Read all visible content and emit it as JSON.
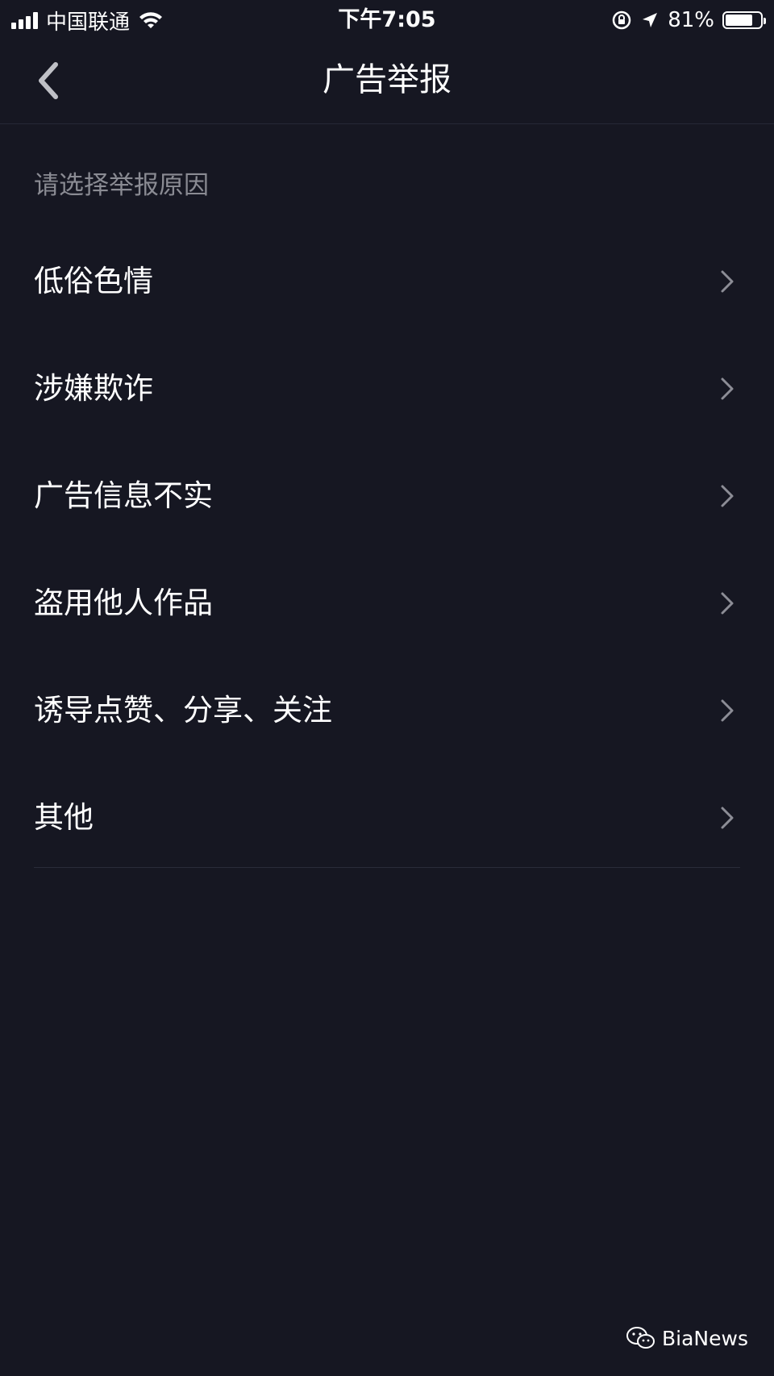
{
  "status_bar": {
    "carrier": "中国联通",
    "time": "下午7:05",
    "battery_percent": "81%",
    "battery_level": 0.81,
    "icons": [
      "signal-icon",
      "wifi-icon",
      "rotation-lock-icon",
      "location-icon",
      "battery-icon"
    ]
  },
  "nav": {
    "title": "广告举报",
    "back_icon": "chevron-left-icon"
  },
  "section": {
    "header": "请选择举报原因"
  },
  "reasons": [
    {
      "label": "低俗色情"
    },
    {
      "label": "涉嫌欺诈"
    },
    {
      "label": "广告信息不实"
    },
    {
      "label": "盗用他人作品"
    },
    {
      "label": "诱导点赞、分享、关注"
    },
    {
      "label": "其他"
    }
  ],
  "watermark": {
    "text": "BiaNews",
    "icon": "wechat-icon"
  },
  "colors": {
    "background": "#161722",
    "text": "#ffffff",
    "secondary_text": "#8a8b93",
    "chevron": "#8c8d96",
    "divider": "#2a2c39"
  }
}
